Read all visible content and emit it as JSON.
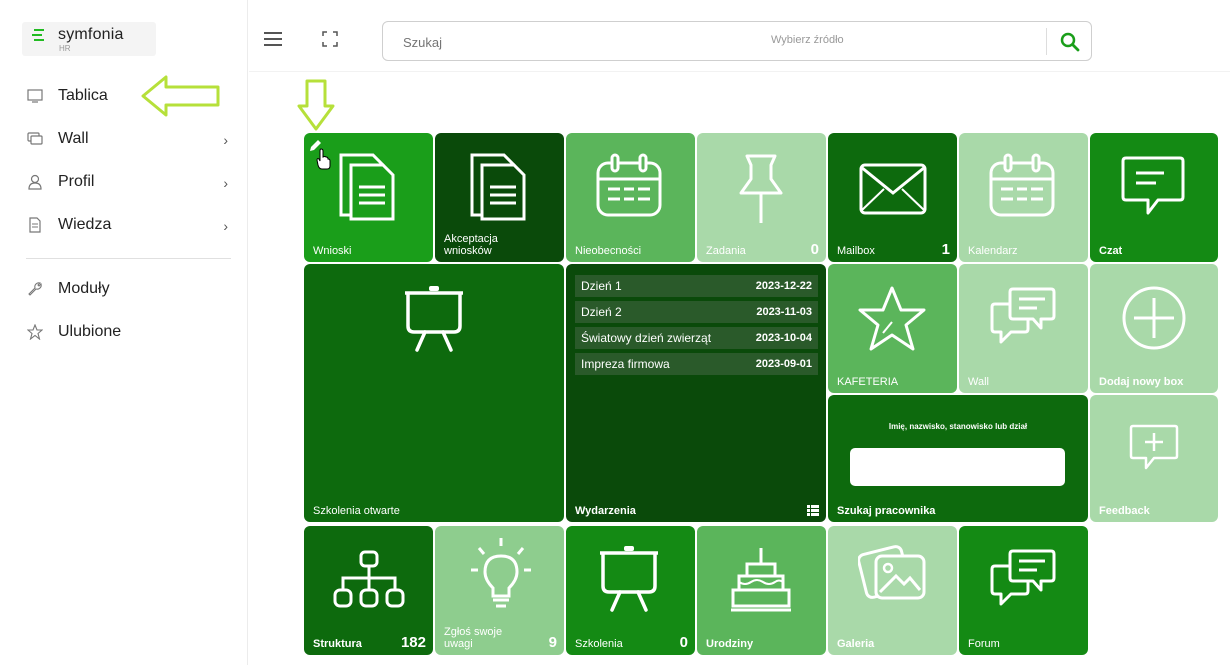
{
  "logo": {
    "brand": "symfonia",
    "sub": "HR"
  },
  "sidebar": {
    "items": [
      {
        "label": "Tablica",
        "icon": "monitor-icon",
        "chevron": false
      },
      {
        "label": "Wall",
        "icon": "chat-icon",
        "chevron": true
      },
      {
        "label": "Profil",
        "icon": "user-icon",
        "chevron": true
      },
      {
        "label": "Wiedza",
        "icon": "document-icon",
        "chevron": true
      },
      {
        "label": "Moduły",
        "icon": "wrench-icon",
        "chevron": false
      },
      {
        "label": "Ulubione",
        "icon": "star-icon",
        "chevron": false
      }
    ]
  },
  "search": {
    "placeholder": "Szukaj",
    "source": "Wybierz źródło"
  },
  "tiles": {
    "wnioski": {
      "label": "Wnioski"
    },
    "akceptacja": {
      "label": "Akceptacja wniosków"
    },
    "nieobecnosci": {
      "label": "Nieobecności"
    },
    "zadania": {
      "label": "Zadania",
      "count": "0"
    },
    "mailbox": {
      "label": "Mailbox",
      "count": "1"
    },
    "kalendarz": {
      "label": "Kalendarz"
    },
    "czat": {
      "label": "Czat"
    },
    "szkolenia_otwarte": {
      "label": "Szkolenia otwarte"
    },
    "wydarzenia": {
      "label": "Wydarzenia"
    },
    "kafeteria": {
      "label": "KAFETERIA"
    },
    "wall": {
      "label": "Wall"
    },
    "dodaj": {
      "label": "Dodaj nowy box"
    },
    "szukaj_pracownika": {
      "label": "Szukaj pracownika",
      "hint": "Imię, nazwisko, stanowisko lub dział"
    },
    "feedback": {
      "label": "Feedback"
    },
    "struktura": {
      "label": "Struktura",
      "count": "182"
    },
    "zglos": {
      "label": "Zgłoś swoje uwagi",
      "count": "9"
    },
    "szkolenia": {
      "label": "Szkolenia",
      "count": "0"
    },
    "urodziny": {
      "label": "Urodziny"
    },
    "galeria": {
      "label": "Galeria"
    },
    "forum": {
      "label": "Forum"
    }
  },
  "events": [
    {
      "name": "Dzień 1",
      "date": "2023-12-22"
    },
    {
      "name": "Dzień 2",
      "date": "2023-11-03"
    },
    {
      "name": "Światowy dzień zwierząt",
      "date": "2023-10-04"
    },
    {
      "name": "Impreza firmowa",
      "date": "2023-09-01"
    }
  ],
  "colors": {
    "accent": "#1a9e1a",
    "highlight_arrow": "#b6e03a"
  }
}
